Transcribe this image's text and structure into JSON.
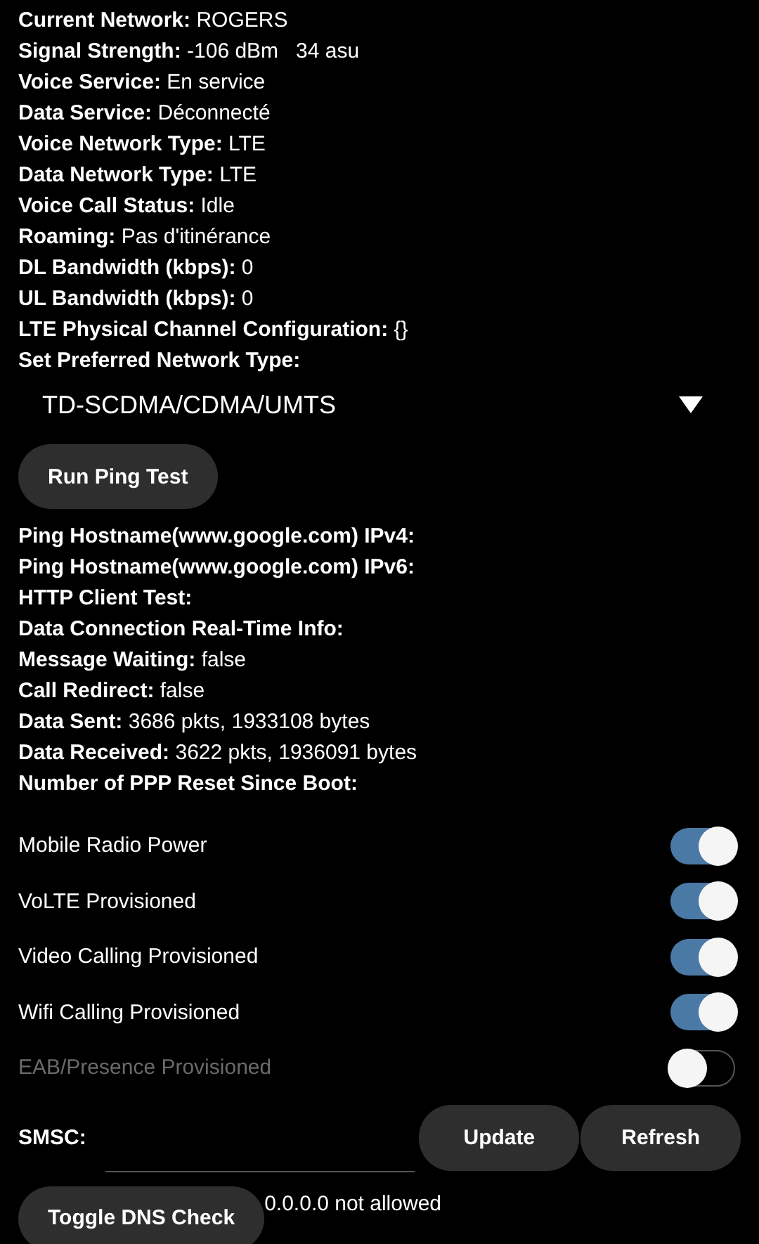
{
  "info": [
    {
      "label": "Current Network:",
      "value": "ROGERS"
    },
    {
      "label": "Signal Strength:",
      "value": "-106 dBm   34 asu"
    },
    {
      "label": "Voice Service:",
      "value": "En service"
    },
    {
      "label": "Data Service:",
      "value": "Déconnecté"
    },
    {
      "label": "Voice Network Type:",
      "value": "LTE"
    },
    {
      "label": "Data Network Type:",
      "value": "LTE"
    },
    {
      "label": "Voice Call Status:",
      "value": "Idle"
    },
    {
      "label": "Roaming:",
      "value": "Pas d'itinérance"
    },
    {
      "label": "DL Bandwidth (kbps):",
      "value": "0"
    },
    {
      "label": "UL Bandwidth (kbps):",
      "value": "0"
    },
    {
      "label": "LTE Physical Channel Configuration:",
      "value": "{}"
    }
  ],
  "preferred_network": {
    "label": "Set Preferred Network Type:",
    "value": "TD-SCDMA/CDMA/UMTS"
  },
  "ping_button": "Run Ping Test",
  "status": [
    {
      "label": "Ping Hostname(www.google.com) IPv4:"
    },
    {
      "label": "Ping Hostname(www.google.com) IPv6:"
    },
    {
      "label": "HTTP Client Test:"
    },
    {
      "label": "Data Connection Real-Time Info:"
    },
    {
      "label": "Message Waiting:",
      "value": "false"
    },
    {
      "label": "Call Redirect:",
      "value": "false"
    },
    {
      "label": "Data Sent:",
      "value": "3686 pkts, 1933108 bytes"
    },
    {
      "label": "Data Received:",
      "value": "3622 pkts, 1936091 bytes"
    },
    {
      "label": "Number of PPP Reset Since Boot:"
    }
  ],
  "toggles": [
    {
      "label": "Mobile Radio Power",
      "on": true,
      "disabled": false
    },
    {
      "label": "VoLTE Provisioned",
      "on": true,
      "disabled": false
    },
    {
      "label": "Video Calling Provisioned",
      "on": true,
      "disabled": false
    },
    {
      "label": "Wifi Calling Provisioned",
      "on": true,
      "disabled": false
    },
    {
      "label": "EAB/Presence Provisioned",
      "on": false,
      "disabled": true
    }
  ],
  "smsc": {
    "label": "SMSC:",
    "buttons": [
      "Update",
      "Refresh"
    ]
  },
  "dns": {
    "button": "Toggle DNS Check",
    "message": "0.0.0.0 not allowed"
  }
}
